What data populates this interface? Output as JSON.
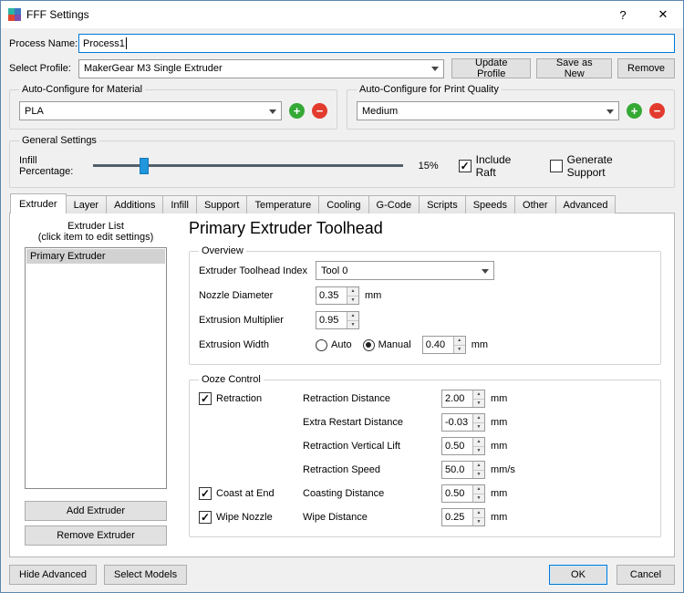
{
  "colors": {
    "accent": "#0078d7",
    "add_green": "#35a935",
    "remove_red": "#e23b2e",
    "slider_handle": "#2196dd"
  },
  "icons": {
    "help": "?",
    "close": "✕",
    "spin_up": "▲",
    "spin_down": "▼",
    "check": "✓",
    "add": "+",
    "remove": "−"
  },
  "window": {
    "title": "FFF Settings",
    "help_label": "?",
    "close_label": "✕"
  },
  "process": {
    "label": "Process Name:",
    "value": "Process1"
  },
  "profile": {
    "label": "Select Profile:",
    "selected": "MakerGear M3 Single Extruder",
    "update_label": "Update Profile",
    "save_label": "Save as New",
    "remove_label": "Remove"
  },
  "material": {
    "title": "Auto-Configure for Material",
    "selected": "PLA",
    "add_label": "+",
    "remove_label": "−"
  },
  "quality": {
    "title": "Auto-Configure for Print Quality",
    "selected": "Medium",
    "add_label": "+",
    "remove_label": "−"
  },
  "general": {
    "title": "General Settings",
    "infill_label": "Infill Percentage:",
    "infill_value": "15%",
    "include_raft": {
      "label": "Include Raft",
      "checked": true
    },
    "generate_support": {
      "label": "Generate Support",
      "checked": false
    }
  },
  "tabs": {
    "selected": "Extruder",
    "items": [
      "Extruder",
      "Layer",
      "Additions",
      "Infill",
      "Support",
      "Temperature",
      "Cooling",
      "G-Code",
      "Scripts",
      "Speeds",
      "Other",
      "Advanced"
    ]
  },
  "extruder_panel": {
    "list_title": "Extruder List",
    "list_subtitle": "(click item to edit settings)",
    "items": [
      "Primary Extruder"
    ],
    "add_label": "Add Extruder",
    "remove_label": "Remove Extruder"
  },
  "toolhead": {
    "title": "Primary Extruder Toolhead",
    "overview": {
      "title": "Overview",
      "index_label": "Extruder Toolhead Index",
      "index_value": "Tool 0",
      "nozzle_label": "Nozzle Diameter",
      "nozzle_value": "0.35",
      "nozzle_unit": "mm",
      "multiplier_label": "Extrusion Multiplier",
      "multiplier_value": "0.95",
      "width_label": "Extrusion Width",
      "width_auto": {
        "label": "Auto",
        "selected": false
      },
      "width_manual": {
        "label": "Manual",
        "selected": true
      },
      "width_value": "0.40",
      "width_unit": "mm"
    },
    "ooze": {
      "title": "Ooze Control",
      "retraction": {
        "label": "Retraction",
        "checked": true
      },
      "coast": {
        "label": "Coast at End",
        "checked": true
      },
      "wipe": {
        "label": "Wipe Nozzle",
        "checked": true
      },
      "rows": [
        {
          "label": "Retraction Distance",
          "value": "2.00",
          "unit": "mm"
        },
        {
          "label": "Extra Restart Distance",
          "value": "-0.03",
          "unit": "mm"
        },
        {
          "label": "Retraction Vertical Lift",
          "value": "0.50",
          "unit": "mm"
        },
        {
          "label": "Retraction Speed",
          "value": "50.0",
          "unit": "mm/s"
        },
        {
          "label": "Coasting Distance",
          "value": "0.50",
          "unit": "mm"
        },
        {
          "label": "Wipe Distance",
          "value": "0.25",
          "unit": "mm"
        }
      ]
    }
  },
  "footer": {
    "hide_advanced_label": "Hide Advanced",
    "select_models_label": "Select Models",
    "ok_label": "OK",
    "cancel_label": "Cancel"
  }
}
